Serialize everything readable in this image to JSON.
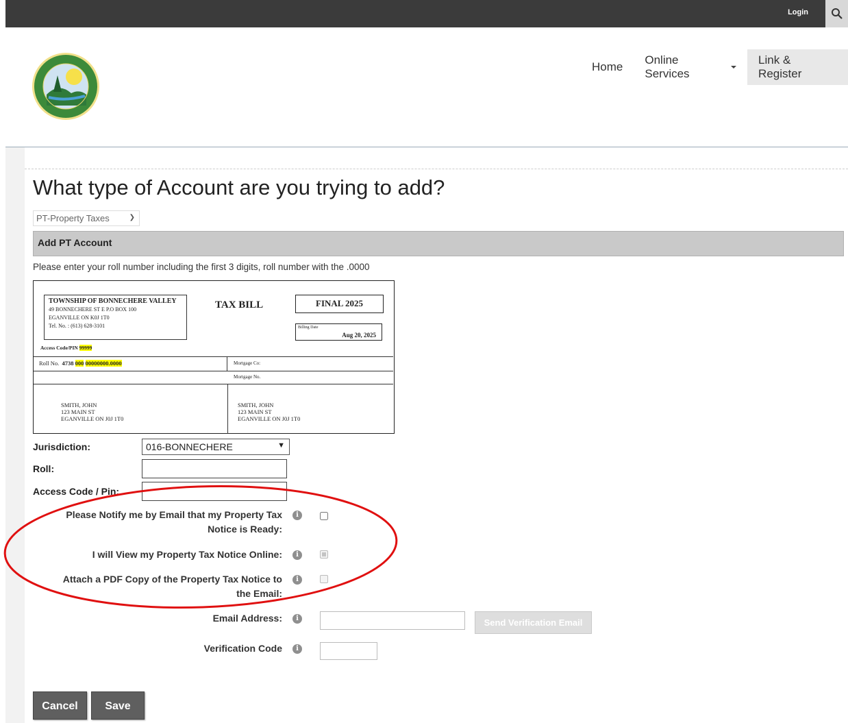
{
  "topbar": {
    "login_label": "Login",
    "search_icon": "search-icon"
  },
  "nav": {
    "home": "Home",
    "online_services": "Online Services",
    "link_register": "Link & Register"
  },
  "page": {
    "title": "What type of Account are you trying to add?",
    "account_type_selected": "PT-Property Taxes",
    "panel_title": "Add PT Account",
    "instructions": "Please enter your roll number including the first 3 digits, roll number with the .0000"
  },
  "sample_bill": {
    "municipality": "TOWNSHIP OF BONNECHERE VALLEY",
    "address1": "49 BONNECHERE ST E P.O BOX 100",
    "address2": "EGANVILLE ON  K0J 1T0",
    "phone": "Tel. No. : (613) 628-3101",
    "title": "TAX BILL",
    "final": "FINAL 2025",
    "billing_date_label": "Billing Date",
    "billing_date": "Aug 20, 2025",
    "access_label": "Access Code/PIN",
    "access_value": "99999",
    "roll_label": "Roll No.",
    "roll_prefix": "4738",
    "roll_part1": "000",
    "roll_part2": "00000000.0000",
    "mortgage_co": "Mortgage Co:",
    "mortgage_no": "Mortgage No.",
    "owner_name": "SMITH, JOHN",
    "owner_street": "123 MAIN ST",
    "owner_city": "EGANVILLE ON J0J 1T0"
  },
  "form": {
    "jurisdiction_label": "Jurisdiction:",
    "jurisdiction_value": "016-BONNECHERE",
    "roll_label": "Roll:",
    "access_label": "Access Code / Pin:",
    "notify_label": "Please Notify me by Email that my Property Tax Notice is Ready:",
    "view_online_label": "I will View my Property Tax Notice Online:",
    "attach_pdf_label": "Attach a PDF Copy of the Property Tax Notice to the Email:",
    "email_label": "Email Address:",
    "send_verification_label": "Send Verification Email",
    "verification_label": "Verification Code"
  },
  "buttons": {
    "cancel": "Cancel",
    "save": "Save"
  },
  "colors": {
    "topbar": "#3b3b3b",
    "button": "#5f5f5f",
    "annotation": "#e01010",
    "highlight": "#ffff00"
  }
}
